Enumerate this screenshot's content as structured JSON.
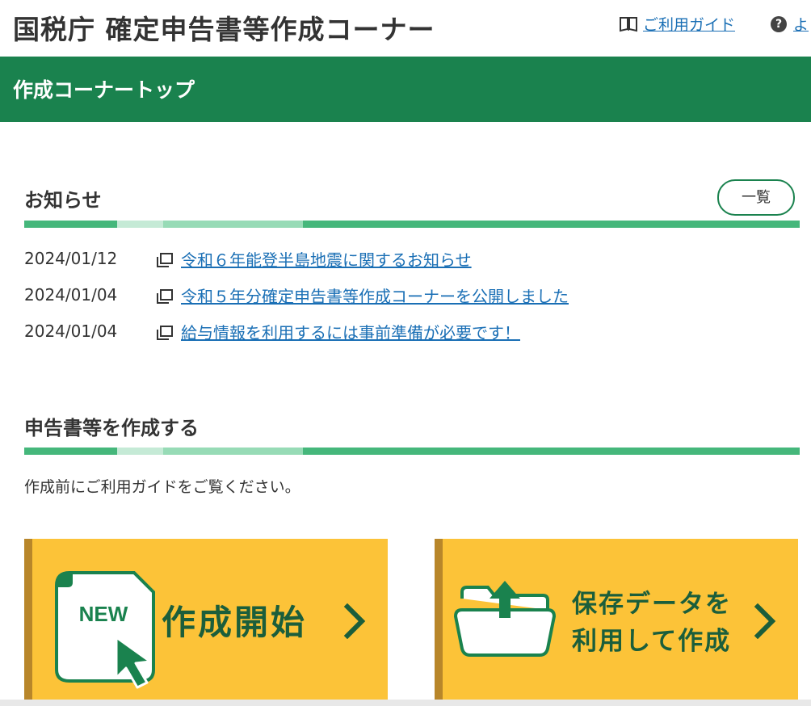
{
  "header": {
    "site_title": "国税庁 確定申告書等作成コーナー",
    "guide_label": "ご利用ガイド",
    "faq_label": "よ"
  },
  "page_bar": {
    "title": "作成コーナートップ"
  },
  "news": {
    "heading": "お知らせ",
    "list_button": "一覧",
    "items": [
      {
        "date": "2024/01/12",
        "title": "令和６年能登半島地震に関するお知らせ"
      },
      {
        "date": "2024/01/04",
        "title": "令和５年分確定申告書等作成コーナーを公開しました"
      },
      {
        "date": "2024/01/04",
        "title": "給与情報を利用するには事前準備が必要です！"
      }
    ]
  },
  "create": {
    "heading": "申告書等を作成する",
    "intro": "作成前にご利用ガイドをご覧ください。",
    "new_button": {
      "badge": "NEW",
      "label": "作成開始"
    },
    "saved_button": {
      "label_line1": "保存データを",
      "label_line2": "利用して作成"
    }
  },
  "icons": {
    "guide": "book-icon",
    "faq": "question-circle-icon",
    "news": "new-window-icon",
    "chevron": "chevron-right-icon"
  },
  "colors": {
    "brand_green": "#1a824e",
    "accent_yellow": "#fcc338",
    "link_blue": "#1a6fb5"
  }
}
